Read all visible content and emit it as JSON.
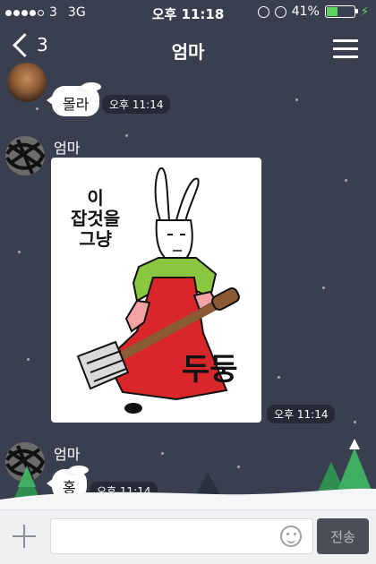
{
  "status_bar": {
    "carrier": "3",
    "network": "3G",
    "time": "오후 11:18",
    "battery_percent": "41%",
    "battery_level": 0.41,
    "battery_color": "#5cd65c"
  },
  "nav": {
    "back_count": "3",
    "title": "엄마"
  },
  "messages": [
    {
      "bubble_text": "몰라",
      "time": "오후 11:14"
    },
    {
      "sender": "엄마",
      "sticker_text_top": "이\n잡것을\n그냥",
      "sticker_text_bottom": "두둥",
      "time": "오후 11:14"
    },
    {
      "sender": "엄마",
      "bubble_text": "홍",
      "time": "오후 11:14"
    }
  ],
  "input_bar": {
    "send_label": "전송",
    "placeholder": ""
  },
  "colors": {
    "background": "#3a3f4f",
    "bubble": "#ffffff",
    "sticker_dress": "#d8262b",
    "sticker_top": "#8bc63f"
  }
}
